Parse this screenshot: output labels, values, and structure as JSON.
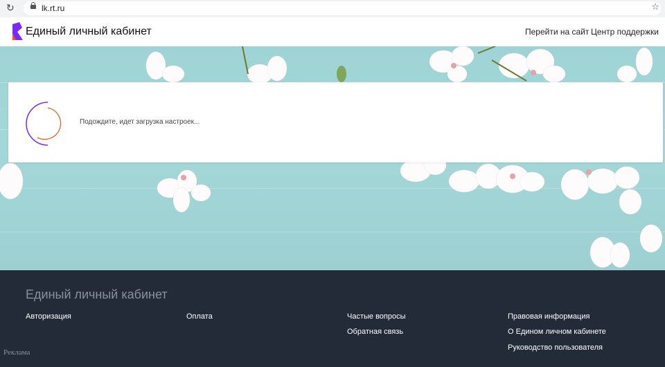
{
  "browser": {
    "url": "lk.rt.ru"
  },
  "header": {
    "brand": "Единый личный кабинет",
    "nav": [
      "Перейти на сайт",
      "Центр поддержки"
    ]
  },
  "loading": {
    "message": "Подождите, идет загрузка настроек..."
  },
  "footer": {
    "title": "Единый личный кабинет",
    "columns": [
      [
        "Авторизация"
      ],
      [
        "Оплата"
      ],
      [
        "Частые вопросы",
        "Обратная связь"
      ],
      [
        "Правовая информация",
        "О Едином личном кабинете",
        "Руководство пользователя"
      ]
    ],
    "ad_label": "Реклама"
  },
  "colors": {
    "accent_purple": "#7b2bf9",
    "accent_orange": "#ff4f12",
    "footer_bg": "#232a38"
  }
}
